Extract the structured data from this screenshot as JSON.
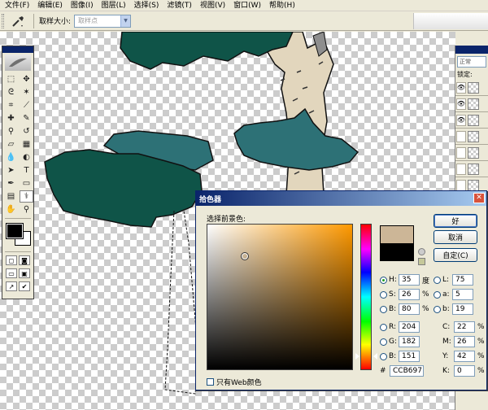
{
  "menubar": {
    "items": [
      "文件(F)",
      "编辑(E)",
      "图像(I)",
      "图层(L)",
      "选择(S)",
      "滤镜(T)",
      "视图(V)",
      "窗口(W)",
      "帮助(H)"
    ]
  },
  "options": {
    "tool_icon": "eyedropper-icon",
    "sample_size_label": "取样大小:",
    "sample_size_value": "取样点"
  },
  "toolbox": {
    "tools": [
      "marquee",
      "move",
      "lasso",
      "magic-wand",
      "crop",
      "slice",
      "healing-brush",
      "brush",
      "clone-stamp",
      "history-brush",
      "eraser",
      "gradient",
      "blur",
      "dodge",
      "path-select",
      "type",
      "pen",
      "shape",
      "notes",
      "eyedropper",
      "hand",
      "zoom"
    ]
  },
  "layers_panel": {
    "mode": "正常",
    "lock_label": "锁定:"
  },
  "picker": {
    "title": "拾色器",
    "prompt": "选择前景色:",
    "ok_label": "好",
    "cancel_label": "取消",
    "custom_label": "自定(C)",
    "web_only_label": "只有Web颜色",
    "hex_prefix": "#",
    "hex": "CCB697",
    "new_color": "#ccb697",
    "old_color": "#000000",
    "fields": {
      "H": {
        "label": "H:",
        "value": "35",
        "unit": "度"
      },
      "S": {
        "label": "S:",
        "value": "26",
        "unit": "%"
      },
      "B": {
        "label": "B:",
        "value": "80",
        "unit": "%"
      },
      "R": {
        "label": "R:",
        "value": "204",
        "unit": ""
      },
      "G": {
        "label": "G:",
        "value": "182",
        "unit": ""
      },
      "Bl": {
        "label": "B:",
        "value": "151",
        "unit": ""
      },
      "L": {
        "label": "L:",
        "value": "75",
        "unit": ""
      },
      "a": {
        "label": "a:",
        "value": "5",
        "unit": ""
      },
      "b": {
        "label": "b:",
        "value": "19",
        "unit": ""
      },
      "C": {
        "label": "C:",
        "value": "22",
        "unit": "%"
      },
      "M": {
        "label": "M:",
        "value": "26",
        "unit": "%"
      },
      "Y": {
        "label": "Y:",
        "value": "42",
        "unit": "%"
      },
      "K": {
        "label": "K:",
        "value": "0",
        "unit": "%"
      }
    }
  },
  "colors": {
    "dark_green": "#0f5448",
    "teal": "#2d7176",
    "trunk": "#e2d6bd"
  }
}
